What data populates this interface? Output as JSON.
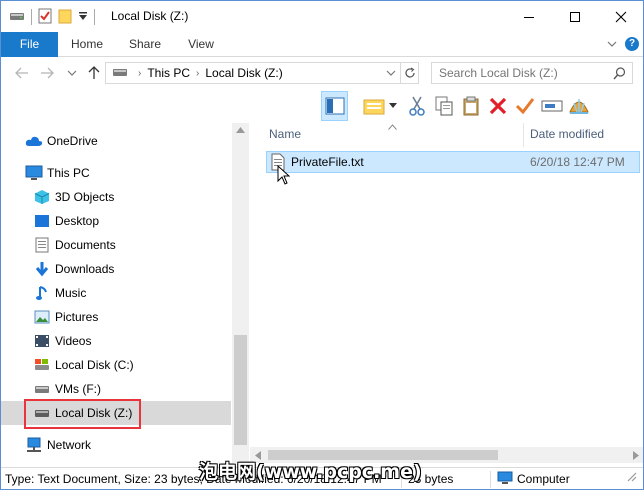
{
  "window": {
    "title": "Local Disk (Z:)"
  },
  "ribbon": {
    "tabs": [
      "File",
      "Home",
      "Share",
      "View"
    ]
  },
  "address": {
    "crumbs": [
      "This PC",
      "Local Disk (Z:)"
    ],
    "search_placeholder": "Search Local Disk (Z:)"
  },
  "nav": {
    "items": [
      {
        "label": "OneDrive",
        "icon": "onedrive-icon"
      },
      {
        "label": "This PC",
        "icon": "this-pc-icon"
      },
      {
        "label": "3D Objects",
        "icon": "3d-objects-icon"
      },
      {
        "label": "Desktop",
        "icon": "desktop-icon"
      },
      {
        "label": "Documents",
        "icon": "documents-icon"
      },
      {
        "label": "Downloads",
        "icon": "downloads-icon"
      },
      {
        "label": "Music",
        "icon": "music-icon"
      },
      {
        "label": "Pictures",
        "icon": "pictures-icon"
      },
      {
        "label": "Videos",
        "icon": "videos-icon"
      },
      {
        "label": "Local Disk (C:)",
        "icon": "drive-c-icon"
      },
      {
        "label": "VMs (F:)",
        "icon": "drive-f-icon"
      },
      {
        "label": "Local Disk (Z:)",
        "icon": "drive-z-icon"
      },
      {
        "label": "Network",
        "icon": "network-icon"
      }
    ]
  },
  "files": {
    "columns": {
      "name": "Name",
      "date": "Date modified"
    },
    "rows": [
      {
        "name": "PrivateFile.txt",
        "date": "6/20/18 12:47 PM"
      }
    ]
  },
  "status": {
    "details": "Type: Text Document, Size: 23 bytes, Date modified: 6/20/18 12:47 PM",
    "size": "23 bytes",
    "location": "Computer"
  },
  "watermark": "泡电网(www.pcpc.me)",
  "colors": {
    "accent": "#1979ca",
    "selection": "#cce8ff",
    "highlight_box": "#e8343a"
  }
}
